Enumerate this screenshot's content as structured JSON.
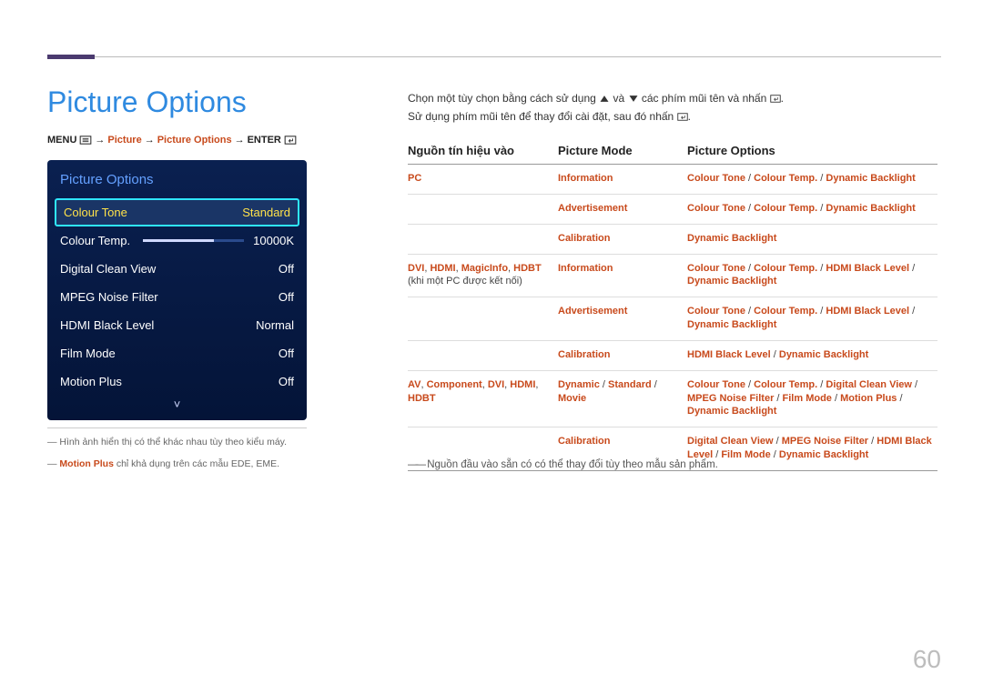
{
  "page_number": "60",
  "title": "Picture Options",
  "breadcrumb": {
    "menu": "MENU",
    "arrow": "→",
    "picture": "Picture",
    "picture_options": "Picture Options",
    "enter": "ENTER"
  },
  "osd": {
    "title": "Picture Options",
    "rows": [
      {
        "label": "Colour Tone",
        "value": "Standard",
        "selected": true
      },
      {
        "label": "Colour Temp.",
        "value": "10000K",
        "slider": true
      },
      {
        "label": "Digital Clean View",
        "value": "Off"
      },
      {
        "label": "MPEG Noise Filter",
        "value": "Off"
      },
      {
        "label": "HDMI Black Level",
        "value": "Normal"
      },
      {
        "label": "Film Mode",
        "value": "Off"
      },
      {
        "label": "Motion Plus",
        "value": "Off"
      }
    ],
    "chevron": "˅"
  },
  "note1": "Hình ảnh hiển thị có thể khác nhau tùy theo kiểu máy.",
  "note2_hl": "Motion Plus",
  "note2_rest": " chỉ khả dụng trên các mẫu EDE, EME.",
  "intro_line1_a": "Chọn một tùy chọn bằng cách sử dụng ",
  "intro_line1_b": " và ",
  "intro_line1_c": " các phím mũi tên và nhấn ",
  "intro_line1_d": ".",
  "intro_line2_a": "Sử dụng phím mũi tên để thay đổi cài đặt, sau đó nhấn ",
  "intro_line2_b": ".",
  "table": {
    "headers": [
      "Nguồn tín hiệu vào",
      "Picture Mode",
      "Picture Options"
    ],
    "sections": [
      {
        "src": [
          {
            "t": "PC",
            "hl": true
          }
        ],
        "rows": [
          {
            "mode": [
              {
                "t": "Information",
                "hl": true
              }
            ],
            "opts": "Colour Tone / Colour Temp. / Dynamic Backlight"
          },
          {
            "mode": [
              {
                "t": "Advertisement",
                "hl": true
              }
            ],
            "opts": "Colour Tone / Colour Temp. / Dynamic Backlight"
          },
          {
            "mode": [
              {
                "t": "Calibration",
                "hl": true
              }
            ],
            "opts": "Dynamic Backlight"
          }
        ]
      },
      {
        "src": [
          {
            "t": "DVI",
            "hl": true
          },
          {
            "t": ", ",
            "hl": false
          },
          {
            "t": "HDMI",
            "hl": true
          },
          {
            "t": ", ",
            "hl": false
          },
          {
            "t": "MagicInfo",
            "hl": true
          },
          {
            "t": ", ",
            "hl": false
          },
          {
            "t": "HDBT",
            "hl": true
          },
          {
            "t": " (khi một PC được kết nối)",
            "hl": false
          }
        ],
        "rows": [
          {
            "mode": [
              {
                "t": "Information",
                "hl": true
              }
            ],
            "opts": "Colour Tone / Colour Temp. / HDMI Black Level / Dynamic Backlight"
          },
          {
            "mode": [
              {
                "t": "Advertisement",
                "hl": true
              }
            ],
            "opts": "Colour Tone / Colour Temp. / HDMI Black Level / Dynamic Backlight"
          },
          {
            "mode": [
              {
                "t": "Calibration",
                "hl": true
              }
            ],
            "opts": "HDMI Black Level / Dynamic Backlight"
          }
        ]
      },
      {
        "src": [
          {
            "t": "AV",
            "hl": true
          },
          {
            "t": ", ",
            "hl": false
          },
          {
            "t": "Component",
            "hl": true
          },
          {
            "t": ", ",
            "hl": false
          },
          {
            "t": "DVI",
            "hl": true
          },
          {
            "t": ", ",
            "hl": false
          },
          {
            "t": "HDMI",
            "hl": true
          },
          {
            "t": ", ",
            "hl": false
          },
          {
            "t": "HDBT",
            "hl": true
          }
        ],
        "rows": [
          {
            "mode": [
              {
                "t": "Dynamic",
                "hl": true
              },
              {
                "t": " / ",
                "hl": false
              },
              {
                "t": "Standard",
                "hl": true
              },
              {
                "t": " / ",
                "hl": false
              },
              {
                "t": "Movie",
                "hl": true
              }
            ],
            "opts": "Colour Tone / Colour Temp. / Digital Clean View / MPEG Noise Filter / Film Mode / Motion Plus / Dynamic Backlight"
          },
          {
            "mode": [
              {
                "t": "Calibration",
                "hl": true
              }
            ],
            "opts": "Digital Clean View / MPEG Noise Filter / HDMI Black Level / Film Mode / Dynamic Backlight"
          }
        ]
      }
    ]
  },
  "footnote": "Nguồn đầu vào sẵn có có thể thay đổi tùy theo mẫu sản phẩm."
}
